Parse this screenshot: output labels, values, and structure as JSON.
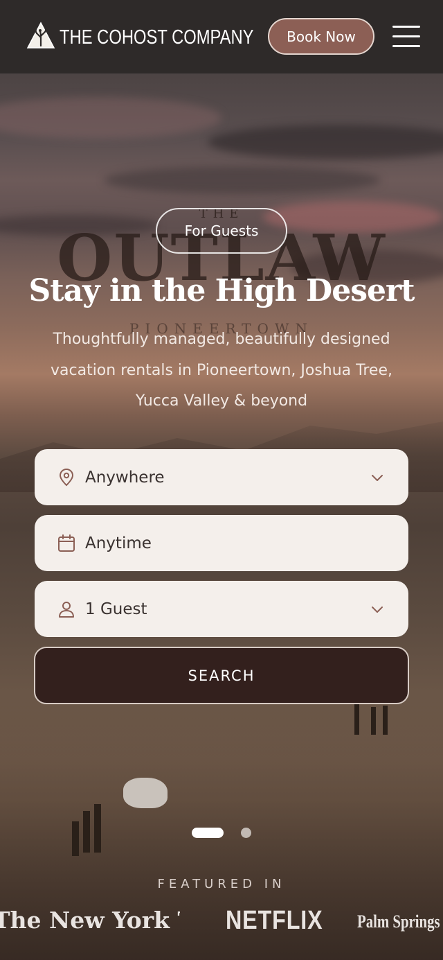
{
  "header": {
    "brand": "THE COHOST COMPANY",
    "book_now_label": "Book Now",
    "menu_icon": "hamburger-menu-icon",
    "logo_icon": "joshua-tree-triangle-logo"
  },
  "background": {
    "sign_the": "THE",
    "sign_main": "OUTLAW",
    "sign_sub": "PIONEERTOWN"
  },
  "hero": {
    "pill_label": "For Guests",
    "title": "Stay in the High Desert",
    "subtitle": "Thoughtfully managed, beautifully designed vacation rentals in Pioneertown, Joshua Tree, Yucca Valley & beyond"
  },
  "search": {
    "location": {
      "value": "Anywhere",
      "icon": "map-pin-icon"
    },
    "dates": {
      "value": "Anytime",
      "icon": "calendar-icon"
    },
    "guests": {
      "value": "1 Guest",
      "icon": "user-icon"
    },
    "submit_label": "SEARCH"
  },
  "carousel": {
    "active_index": 0,
    "count": 2
  },
  "featured": {
    "label": "FEATURED IN",
    "outlets": [
      "The New York Times",
      "NETFLIX",
      "Palm Springs Life"
    ]
  },
  "colors": {
    "header_bg": "#2e2a29",
    "book_button": "#8c5f55",
    "search_button": "#33201d",
    "field_bg": "#f4efeb"
  }
}
